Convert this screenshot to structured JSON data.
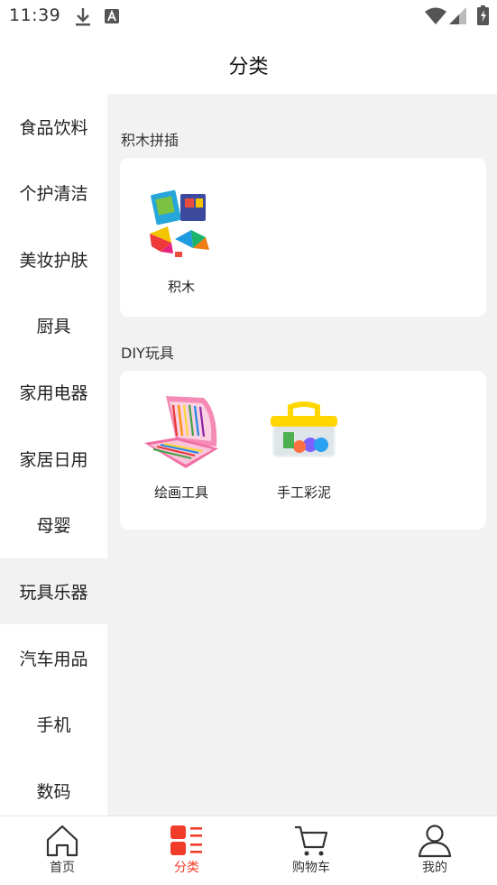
{
  "status_bar": {
    "time": "11:39"
  },
  "header": {
    "title": "分类"
  },
  "sidebar": {
    "items": [
      {
        "label": "食品饮料"
      },
      {
        "label": "个护清洁"
      },
      {
        "label": "美妆护肤"
      },
      {
        "label": "厨具"
      },
      {
        "label": "家用电器"
      },
      {
        "label": "家居日用"
      },
      {
        "label": "母婴"
      },
      {
        "label": "玩具乐器",
        "active": true
      },
      {
        "label": "汽车用品"
      },
      {
        "label": "手机"
      },
      {
        "label": "数码"
      }
    ]
  },
  "sections": [
    {
      "title": "积木拼插",
      "products": [
        {
          "name": "积木"
        }
      ]
    },
    {
      "title": "DIY玩具",
      "products": [
        {
          "name": "绘画工具"
        },
        {
          "name": "手工彩泥"
        }
      ]
    }
  ],
  "tabbar": {
    "tabs": [
      {
        "label": "首页",
        "icon": "home-icon"
      },
      {
        "label": "分类",
        "icon": "category-icon",
        "active": true
      },
      {
        "label": "购物车",
        "icon": "cart-icon"
      },
      {
        "label": "我的",
        "icon": "user-icon"
      }
    ]
  },
  "colors": {
    "accent": "#f23c2a",
    "panel_bg": "#f2f2f2"
  }
}
